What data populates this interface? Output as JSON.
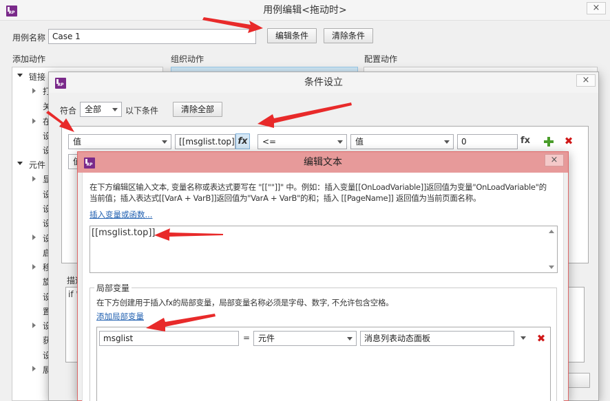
{
  "main_window": {
    "title": "用例编辑<拖动时>",
    "close": "×",
    "case_name_label": "用例名称",
    "case_name_value": "Case 1",
    "edit_condition_button": "编辑条件",
    "clear_condition_button": "清除条件",
    "add_action_header": "添加动作",
    "organize_action_header": "组织动作",
    "configure_action_header": "配置动作",
    "tree": [
      {
        "label": "链接"
      },
      {
        "label": "打"
      },
      {
        "label": "关"
      },
      {
        "label": "在"
      },
      {
        "label": "设"
      },
      {
        "label": "设"
      },
      {
        "label": "元件"
      },
      {
        "label": "显"
      },
      {
        "label": "设"
      },
      {
        "label": "设"
      },
      {
        "label": "设"
      },
      {
        "label": "设"
      },
      {
        "label": "启"
      },
      {
        "label": "移"
      },
      {
        "label": "旋"
      },
      {
        "label": "设"
      },
      {
        "label": "置"
      },
      {
        "label": "设"
      },
      {
        "label": "获"
      },
      {
        "label": "设"
      },
      {
        "label": "展"
      }
    ]
  },
  "condition_window": {
    "title": "条件设立",
    "close": "×",
    "match_label": "符合",
    "match_value": "全部",
    "below_label": "以下条件",
    "clear_all_button": "清除全部",
    "row1": {
      "type": "值",
      "value": "[[msglist.top]]",
      "fx": "fx",
      "operator": "<=",
      "type2": "值",
      "value2": "0",
      "fx2": "fx"
    },
    "row2_type": "值",
    "describe_label": "描述",
    "describe_value": "if \""
  },
  "edit_text_window": {
    "title": "编辑文本",
    "close": "×",
    "instructions_line1": "在下方编辑区输入文本, 变量名称或表达式要写在 \"[[\"\"]]\" 中。例如：插入变量[[OnLoadVariable]]返回值为变量\"OnLoadVariable\"的",
    "instructions_line2": "当前值；插入表达式[[VarA + VarB]]返回值为\"VarA + VarB\"的和；插入 [[PageName]] 返回值为当前页面名称。",
    "insert_variable_link": "插入变量或函数...",
    "text_value": "[[msglist.top]]",
    "local_vars_title": "局部变量",
    "local_vars_desc": "在下方创建用于插入fx的局部变量，局部变量名称必须是字母、数字, 不允许包含空格。",
    "add_local_var_link": "添加局部变量",
    "local_var": {
      "name": "msglist",
      "equals": "=",
      "type": "元件",
      "target": "消息列表动态面板"
    }
  },
  "colors": {
    "arrow": "#e82a2a",
    "titlebar_pink": "#e79a9a",
    "link": "#1f5fb0",
    "logo": "#7a2a8a"
  }
}
